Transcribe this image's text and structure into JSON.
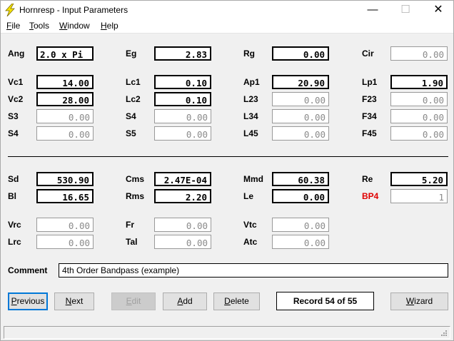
{
  "window": {
    "title": "Hornresp - Input Parameters",
    "controls": {
      "minimize": "—",
      "maximize": "☐",
      "close": "✕"
    }
  },
  "menu": {
    "file": {
      "u": "F",
      "rest": "ile"
    },
    "tools": {
      "u": "T",
      "rest": "ools"
    },
    "window": {
      "u": "W",
      "rest": "indow"
    },
    "help": {
      "u": "H",
      "rest": "elp"
    }
  },
  "params": {
    "ang": {
      "label": "Ang",
      "value": "2.0 x Pi"
    },
    "eg": {
      "label": "Eg",
      "value": "2.83"
    },
    "rg": {
      "label": "Rg",
      "value": "0.00"
    },
    "cir": {
      "label": "Cir",
      "value": "0.00"
    },
    "vc1": {
      "label": "Vc1",
      "value": "14.00"
    },
    "lc1": {
      "label": "Lc1",
      "value": "0.10"
    },
    "ap1": {
      "label": "Ap1",
      "value": "20.90"
    },
    "lp1": {
      "label": "Lp1",
      "value": "1.90"
    },
    "vc2": {
      "label": "Vc2",
      "value": "28.00"
    },
    "lc2": {
      "label": "Lc2",
      "value": "0.10"
    },
    "l23": {
      "label": "L23",
      "value": "0.00"
    },
    "f23": {
      "label": "F23",
      "value": "0.00"
    },
    "s3": {
      "label": "S3",
      "value": "0.00"
    },
    "s4b": {
      "label": "S4",
      "value": "0.00"
    },
    "l34": {
      "label": "L34",
      "value": "0.00"
    },
    "f34": {
      "label": "F34",
      "value": "0.00"
    },
    "s4": {
      "label": "S4",
      "value": "0.00"
    },
    "s5": {
      "label": "S5",
      "value": "0.00"
    },
    "l45": {
      "label": "L45",
      "value": "0.00"
    },
    "f45": {
      "label": "F45",
      "value": "0.00"
    },
    "sd": {
      "label": "Sd",
      "value": "530.90"
    },
    "cms": {
      "label": "Cms",
      "value": "2.47E-04"
    },
    "mmd": {
      "label": "Mmd",
      "value": "60.38"
    },
    "re": {
      "label": "Re",
      "value": "5.20"
    },
    "bl": {
      "label": "Bl",
      "value": "16.65"
    },
    "rms": {
      "label": "Rms",
      "value": "2.20"
    },
    "le": {
      "label": "Le",
      "value": "0.00"
    },
    "bp4": {
      "label": "BP4",
      "value": "1"
    },
    "vrc": {
      "label": "Vrc",
      "value": "0.00"
    },
    "fr": {
      "label": "Fr",
      "value": "0.00"
    },
    "vtc": {
      "label": "Vtc",
      "value": "0.00"
    },
    "lrc": {
      "label": "Lrc",
      "value": "0.00"
    },
    "tal": {
      "label": "Tal",
      "value": "0.00"
    },
    "atc": {
      "label": "Atc",
      "value": "0.00"
    }
  },
  "comment": {
    "label": "Comment",
    "value": "4th Order Bandpass (example)"
  },
  "buttons": {
    "previous": {
      "u": "P",
      "rest": "revious"
    },
    "next": {
      "u": "N",
      "rest": "ext"
    },
    "edit": {
      "u": "E",
      "rest": "dit"
    },
    "add": {
      "u": "A",
      "rest": "dd"
    },
    "delete": {
      "u": "D",
      "rest": "elete"
    },
    "wizard": {
      "u": "W",
      "rest": "izard"
    }
  },
  "record": "Record 54 of 55",
  "colors": {
    "highlight_label": "#e00000",
    "focus_border": "#0078d7"
  }
}
